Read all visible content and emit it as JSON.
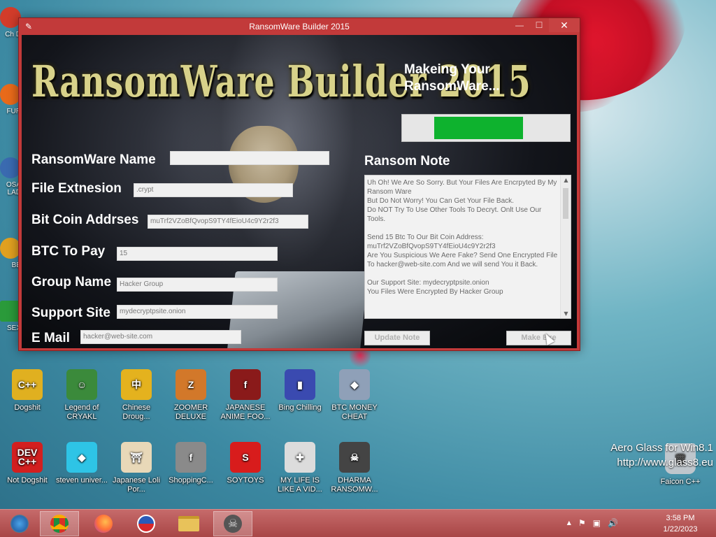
{
  "window": {
    "title": "RansomWare Builder 2015",
    "logo_text": "RansomWare Builder 2015",
    "minimize_glyph": "—",
    "maximize_glyph": "☐",
    "close_glyph": "✕"
  },
  "status": {
    "text": "Makeing Your RansomWare...",
    "progress_start": 0.19,
    "progress_end": 0.72
  },
  "form": {
    "name_label": "RansomWare Name",
    "name_value": "",
    "ext_label": "File Extnesion",
    "ext_value": ".crypt",
    "btc_addr_label": "Bit Coin Addrses",
    "btc_addr_value": "muTrf2VZoBfQvopS9TY4fEioU4c9Y2r2f3",
    "btc_pay_label": "BTC To Pay",
    "btc_pay_value": "15",
    "group_label": "Group Name",
    "group_value": "Hacker Group",
    "site_label": "Support Site",
    "site_value": "mydecryptpsite.onion",
    "email_label": "E Mail",
    "email_value": "hacker@web-site.com"
  },
  "note": {
    "title": "Ransom Note",
    "text": "Uh Oh! We Are So Sorry. But Your Files Are Encrpyted By My Ransom Ware\nBut Do Not Worry! You Can Get Your File Back.\nDo NOT Try To Use Other Tools To Decryt. Onlt Use Our Tools.\n\nSend 15 Btc To Our Bit Coin Address:\nmuTrf2VZoBfQvopS9TY4fEioU4c9Y2r2f3\nAre You Suspicious We Aere Fake? Send One Encrypted File To hacker@web-site.com And we will send You it Back.\n\nOur Support Site: mydecryptpsite.onion\nYou Files Were Encrypted By Hacker Group"
  },
  "buttons": {
    "update_note": "Update Note",
    "make_exe": "Make Exe"
  },
  "desktop": {
    "left_labels": [
      "Ch D",
      "FUR",
      "OSA LAD",
      "BE",
      "SEX"
    ],
    "row1": [
      {
        "label": "Dogshit",
        "icon": "dogshit-icon",
        "color": "#e0b020",
        "glyph": "C++"
      },
      {
        "label": "Legend of CRYAKL",
        "icon": "pixel-character-icon",
        "color": "#3b8a3b",
        "glyph": "☺"
      },
      {
        "label": "Chinese Droug...",
        "icon": "mahjong-tile-icon",
        "color": "#e4b21e",
        "glyph": "中"
      },
      {
        "label": "ZOOMER DELUXE",
        "icon": "zuma-icon",
        "color": "#d2782a",
        "glyph": "Z"
      },
      {
        "label": "JAPANESE ANIME FOO...",
        "icon": "flash-icon",
        "color": "#8a1a1a",
        "glyph": "f"
      },
      {
        "label": "Bing Chilling",
        "icon": "book-icon",
        "color": "#3a4ab0",
        "glyph": "▮"
      },
      {
        "label": "BTC MONEY CHEAT",
        "icon": "diamond-file-icon",
        "color": "#8fa0b8",
        "glyph": "◆"
      }
    ],
    "row2": [
      {
        "label": "Not Dogshit",
        "icon": "dev-cpp-icon",
        "color": "#d21f1f",
        "glyph": "DEV C++"
      },
      {
        "label": "steven univer...",
        "icon": "gem-icon",
        "color": "#2ec4e6",
        "glyph": "◆"
      },
      {
        "label": "Japanese Loli Por...",
        "icon": "torii-icon",
        "color": "#e8d8b8",
        "glyph": "⛩"
      },
      {
        "label": "ShoppingC...",
        "icon": "flash-player-icon",
        "color": "#8a8a8a",
        "glyph": "f"
      },
      {
        "label": "SOYTOYS",
        "icon": "s-logo-icon",
        "color": "#d81c1c",
        "glyph": "S"
      },
      {
        "label": "MY LIFE IS LIKE A VID...",
        "icon": "gamepad-icon",
        "color": "#dcdcdc",
        "glyph": "✚"
      },
      {
        "label": "DHARMA RANSOMW...",
        "icon": "skull-icon",
        "color": "#444444",
        "glyph": "☠"
      }
    ],
    "recycle_label": "Faicon C++",
    "watermark_line1": "Aero Glass for Win8.1",
    "watermark_line2": "http://www.glass8.eu"
  },
  "taskbar": {
    "time": "3:58 PM",
    "date": "1/22/2023",
    "tray_up": "▲",
    "tray_flag": "⚑",
    "tray_network": "▣",
    "tray_volume": "🔊"
  }
}
